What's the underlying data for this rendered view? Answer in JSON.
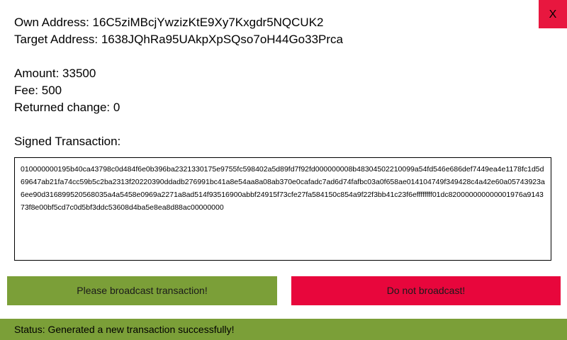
{
  "window": {
    "close_label": "X"
  },
  "transaction": {
    "own_address": "Own Address: 16C5ziMBcjYwzizKtE9Xy7Kxgdr5NQCUK2",
    "target_address": "Target Address: 1638JQhRa95UAkpXpSQso7oH44Go33Prca",
    "amount": "Amount: 33500",
    "fee": "Fee: 500",
    "returned_change": "Returned change: 0",
    "signed_label": "Signed Transaction:",
    "signed_hex": "010000000195b40ca43798c0d484f6e0b396ba2321330175e9755fc598402a5d89fd7f92fd000000008b48304502210099a54fd546e686def7449ea4e1178fc1d5d69647ab21fa74cc59b5c2ba2313f20220390ddadb276991bc41a8e54aa8a08ab370e0cafadc7ad6d74fafbc03a0f658ae014104749f349428c4a42e60a05743923a6ee90d316899520568035a4a5458e0969a2271a8ad514f93516900abbf24915f73cfe27fa584150c854a9f22f3bb41c23f6effffffff01dc820000000000001976a914373f8e00bf5cd7c0d5bf3ddc53608d4ba5e8ea8d88ac00000000"
  },
  "actions": {
    "broadcast_label": "Please broadcast transaction!",
    "no_broadcast_label": "Do not broadcast!"
  },
  "status": {
    "text": "Status: Generated a new transaction successfully!"
  },
  "colors": {
    "accent_green": "#7b9f38",
    "accent_red": "#e8063c"
  }
}
